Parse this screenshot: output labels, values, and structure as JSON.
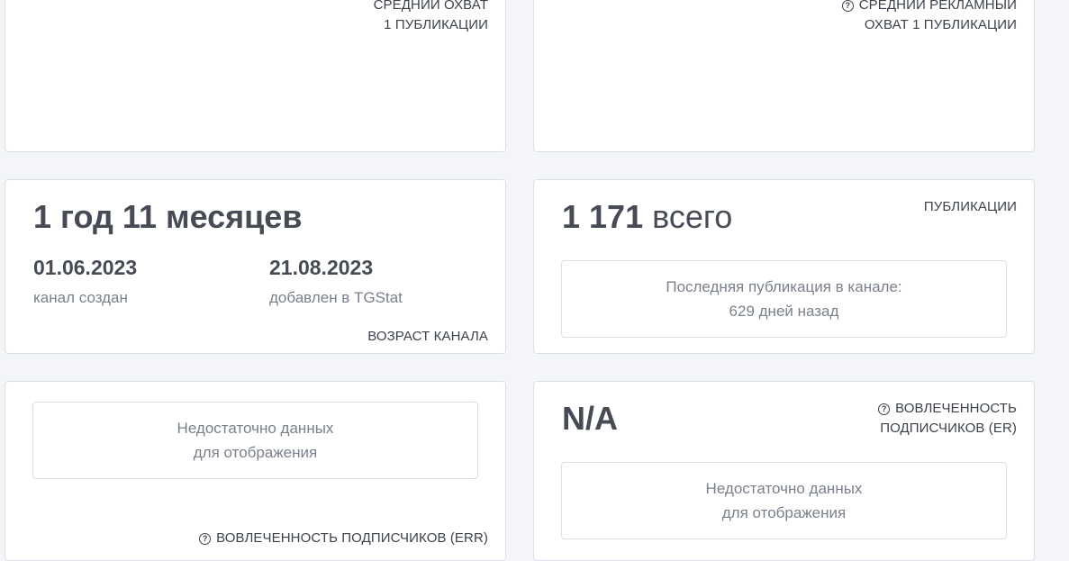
{
  "reach_card": {
    "label_line1": "СРЕДНИЙ ОХВАТ",
    "label_line2": "1 ПУБЛИКАЦИИ"
  },
  "ad_reach_card": {
    "icon": "question-circle-icon",
    "label_line1": "СРЕДНИЙ РЕКЛАМНЫЙ",
    "label_line2": "ОХВАТ 1 ПУБЛИКАЦИИ"
  },
  "age_card": {
    "value": "1 год 11 месяцев",
    "created_date": "01.06.2023",
    "created_label": "канал создан",
    "added_date": "21.08.2023",
    "added_label": "добавлен в TGStat",
    "label": "ВОЗРАСТ КАНАЛА"
  },
  "posts_card": {
    "count": "1 171",
    "unit": "всего",
    "label": "ПУБЛИКАЦИИ",
    "last_post_line1": "Последняя публикация в канале:",
    "last_post_line2": "629 дней назад"
  },
  "err_card": {
    "notice_line1": "Недостаточно данных",
    "notice_line2": "для отображения",
    "icon": "question-circle-icon",
    "label": "ВОВЛЕЧЕННОСТЬ ПОДПИСЧИКОВ (ERR)"
  },
  "er_card": {
    "value": "N/A",
    "icon": "question-circle-icon",
    "label_line1": "ВОВЛЕЧЕННОСТЬ",
    "label_line2": "ПОДПИСЧИКОВ (ER)",
    "notice_line1": "Недостаточно данных",
    "notice_line2": "для отображения"
  }
}
